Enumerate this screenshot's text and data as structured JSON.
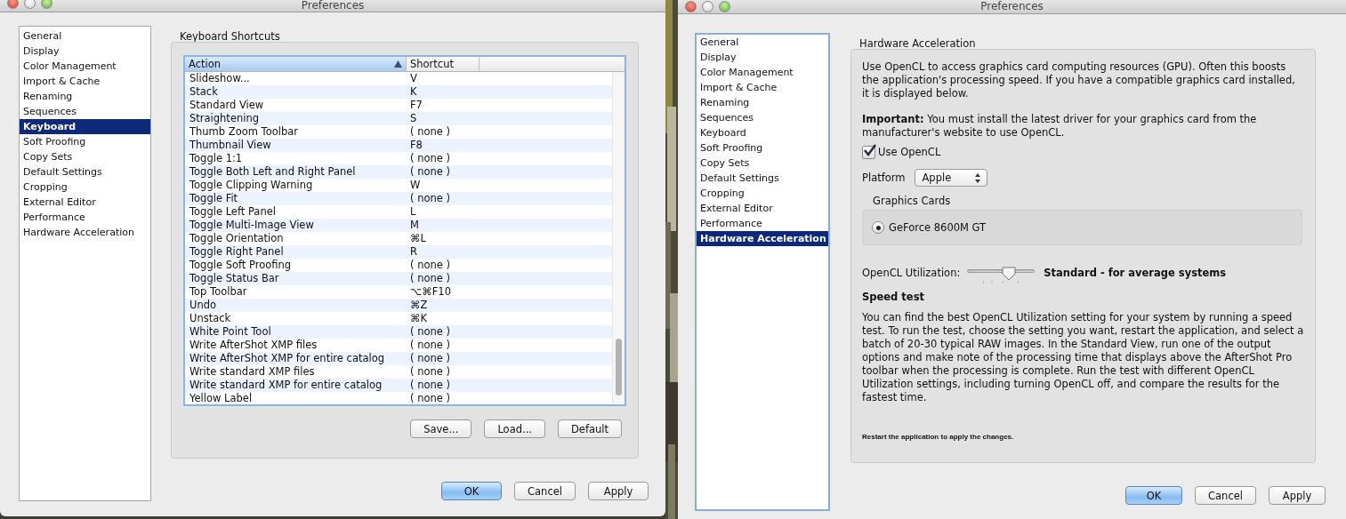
{
  "windows": [
    {
      "kind": "keyboard",
      "title": "Preferences",
      "sidebar": {
        "items": [
          {
            "label": "General",
            "selected": false
          },
          {
            "label": "Display",
            "selected": false
          },
          {
            "label": "Color Management",
            "selected": false
          },
          {
            "label": "Import & Cache",
            "selected": false
          },
          {
            "label": "Renaming",
            "selected": false
          },
          {
            "label": "Sequences",
            "selected": false
          },
          {
            "label": "Keyboard",
            "selected": true
          },
          {
            "label": "Soft Proofing",
            "selected": false
          },
          {
            "label": "Copy Sets",
            "selected": false
          },
          {
            "label": "Default Settings",
            "selected": false
          },
          {
            "label": "Cropping",
            "selected": false
          },
          {
            "label": "External Editor",
            "selected": false
          },
          {
            "label": "Performance",
            "selected": false
          },
          {
            "label": "Hardware Acceleration",
            "selected": false
          }
        ]
      },
      "panel": {
        "title": "Keyboard Shortcuts",
        "table": {
          "columns": [
            {
              "label": "Action",
              "sorted_ascending": true
            },
            {
              "label": "Shortcut",
              "sorted_ascending": false
            }
          ],
          "rows": [
            {
              "action": "Slideshow...",
              "shortcut": "V"
            },
            {
              "action": "Stack",
              "shortcut": "K"
            },
            {
              "action": "Standard View",
              "shortcut": "F7"
            },
            {
              "action": "Straightening",
              "shortcut": "S"
            },
            {
              "action": "Thumb Zoom Toolbar",
              "shortcut": "( none )"
            },
            {
              "action": "Thumbnail View",
              "shortcut": "F8"
            },
            {
              "action": "Toggle 1:1",
              "shortcut": "( none )"
            },
            {
              "action": "Toggle Both Left and Right Panel",
              "shortcut": "( none )"
            },
            {
              "action": "Toggle Clipping Warning",
              "shortcut": "W"
            },
            {
              "action": "Toggle Fit",
              "shortcut": "( none )"
            },
            {
              "action": "Toggle Left Panel",
              "shortcut": "L"
            },
            {
              "action": "Toggle Multi-Image View",
              "shortcut": "M"
            },
            {
              "action": "Toggle Orientation",
              "shortcut": "⌘L"
            },
            {
              "action": "Toggle Right Panel",
              "shortcut": "R"
            },
            {
              "action": "Toggle Soft Proofing",
              "shortcut": "( none )"
            },
            {
              "action": "Toggle Status Bar",
              "shortcut": "( none )"
            },
            {
              "action": "Top Toolbar",
              "shortcut": "⌥⌘F10"
            },
            {
              "action": "Undo",
              "shortcut": "⌘Z"
            },
            {
              "action": "Unstack",
              "shortcut": "⌘K"
            },
            {
              "action": "White Point Tool",
              "shortcut": "( none )"
            },
            {
              "action": "Write AfterShot XMP files",
              "shortcut": "( none )"
            },
            {
              "action": "Write AfterShot XMP for entire catalog",
              "shortcut": "( none )"
            },
            {
              "action": "Write standard XMP files",
              "shortcut": "( none )"
            },
            {
              "action": "Write standard XMP for entire catalog",
              "shortcut": "( none )"
            },
            {
              "action": "Yellow Label",
              "shortcut": "( none )"
            }
          ]
        },
        "buttons": [
          "Save...",
          "Load...",
          "Default"
        ]
      },
      "footer_buttons": [
        {
          "label": "OK",
          "default": true
        },
        {
          "label": "Cancel",
          "default": false
        },
        {
          "label": "Apply",
          "default": false
        }
      ]
    },
    {
      "kind": "hardware",
      "title": "Preferences",
      "sidebar": {
        "items": [
          {
            "label": "General",
            "selected": false
          },
          {
            "label": "Display",
            "selected": false
          },
          {
            "label": "Color Management",
            "selected": false
          },
          {
            "label": "Import & Cache",
            "selected": false
          },
          {
            "label": "Renaming",
            "selected": false
          },
          {
            "label": "Sequences",
            "selected": false
          },
          {
            "label": "Keyboard",
            "selected": false
          },
          {
            "label": "Soft Proofing",
            "selected": false
          },
          {
            "label": "Copy Sets",
            "selected": false
          },
          {
            "label": "Default Settings",
            "selected": false
          },
          {
            "label": "Cropping",
            "selected": false
          },
          {
            "label": "External Editor",
            "selected": false
          },
          {
            "label": "Performance",
            "selected": false
          },
          {
            "label": "Hardware Acceleration",
            "selected": true
          }
        ]
      },
      "panel": {
        "title": "Hardware Acceleration",
        "intro": "Use OpenCL to access graphics card computing resources (GPU). Often this boosts the application's processing speed. If you have a compatible graphics card installed, it is displayed below.",
        "important": "**Important:** You must install the latest driver for your graphics card from the manufacturer's website to use OpenCL.",
        "use_opencl": {
          "label": "Use OpenCL",
          "checked": true
        },
        "platform": {
          "label": "Platform",
          "value": "Apple"
        },
        "graphics_cards": {
          "title": "Graphics Cards",
          "cards": [
            {
              "label": "GeForce 8600M GT",
              "selected": true
            }
          ]
        },
        "utilization": {
          "label": "OpenCL Utilization:",
          "level": 0.62,
          "reading": "Standard - for average systems"
        },
        "speed_test": {
          "title": "Speed test",
          "text": "You can find the best OpenCL Utilization setting for your system by running a speed test. To run the test, choose the setting you want, restart the application, and select a batch of 20-30 typical RAW images. In the Standard View, run one of the output options and make note of the processing time that displays above the AfterShot Pro toolbar when the processing is complete. Run the test with different OpenCL Utilization settings, including turning OpenCL off, and compare the results for the fastest time."
        },
        "note": "Restart the application to apply the changes."
      },
      "footer_buttons": [
        {
          "label": "OK",
          "default": true
        },
        {
          "label": "Cancel",
          "default": false
        },
        {
          "label": "Apply",
          "default": false
        }
      ]
    }
  ]
}
